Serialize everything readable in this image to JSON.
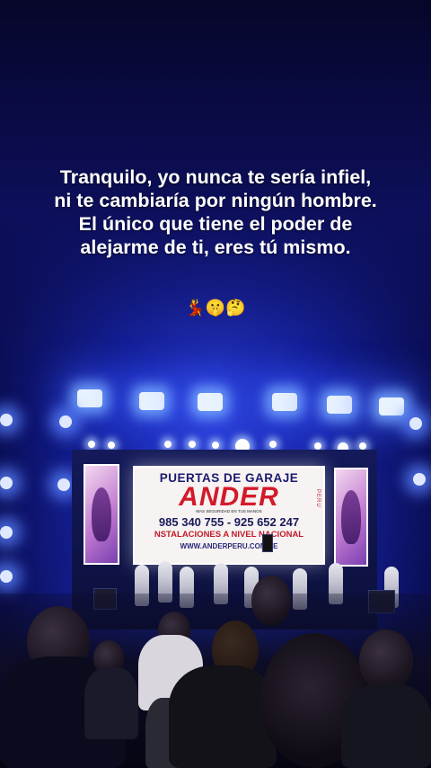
{
  "caption": {
    "text": "Tranquilo, yo nunca te sería infiel, ni te cambiaría por ningún hombre. El único que tiene el poder de alejarme de ti, eres tú mismo.",
    "emojis": "💃🤫🤔"
  },
  "banner": {
    "line1": "PUERTAS DE GARAJE",
    "brand": "ANDER",
    "tagline": "MAS SEGURIDAD EN TUS MANOS",
    "phones": "985 340 755 - 925 652 247",
    "service": "NSTALACIONES A NIVEL NACIONAL",
    "website": "WWW.ANDERPERU.COM.PE",
    "side": "PERU"
  },
  "colors": {
    "banner_red": "#d31a2a",
    "banner_navy": "#1a1a6e",
    "stage_blue": "#1624a6"
  }
}
